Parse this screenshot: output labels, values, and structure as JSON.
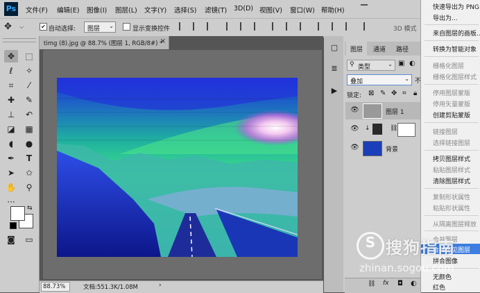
{
  "menubar": {
    "logo": "Ps",
    "items": [
      "文件(F)",
      "编辑(E)",
      "图像(I)",
      "图层(L)",
      "文字(Y)",
      "选择(S)",
      "滤镜(T)",
      "3D(D)",
      "视图(V)",
      "窗口(W)",
      "帮助(H)"
    ]
  },
  "options": {
    "auto_select_label": "自动选择:",
    "auto_select_value": "图层",
    "show_transform_label": "显示变换控件",
    "mode_3d": "3D 模式"
  },
  "document": {
    "tab_title": "timg (8).jpg @ 88.7% (图层 1, RGB/8#) *",
    "zoom": "88.73%",
    "doc_info": "文档:551.3K/1.08M"
  },
  "panels": {
    "tabs": [
      "图层",
      "通道",
      "路径"
    ],
    "filter_kind": "类型",
    "blend_mode": "叠加",
    "opacity_partial": "不",
    "lock_label": "锁定:",
    "layers": [
      {
        "name": "图层 1"
      },
      {
        "name": "背景"
      }
    ]
  },
  "context_menu": {
    "items": [
      {
        "label": "快速导出为 PNG",
        "disabled": false
      },
      {
        "label": "导出为...",
        "disabled": false
      },
      {
        "label": "来自图层的画板...",
        "disabled": false
      },
      {
        "label": "转换为智能对象",
        "disabled": false
      },
      {
        "label": "栅格化图层",
        "disabled": true
      },
      {
        "label": "栅格化图层样式",
        "disabled": true
      },
      {
        "label": "停用图层蒙版",
        "disabled": true
      },
      {
        "label": "停用矢量蒙版",
        "disabled": true
      },
      {
        "label": "创建剪贴蒙版",
        "disabled": false
      },
      {
        "label": "链接图层",
        "disabled": true
      },
      {
        "label": "选择链接图层",
        "disabled": true
      },
      {
        "label": "拷贝图层样式",
        "disabled": false
      },
      {
        "label": "粘贴图层样式",
        "disabled": true
      },
      {
        "label": "清除图层样式",
        "disabled": false
      },
      {
        "label": "复制形状属性",
        "disabled": true
      },
      {
        "label": "粘贴形状属性",
        "disabled": true
      },
      {
        "label": "从隔离图层释放",
        "disabled": true
      },
      {
        "label": "合并图层",
        "disabled": true
      },
      {
        "label": "合并可见图层",
        "disabled": false,
        "highlighted": true
      },
      {
        "label": "拼合图像",
        "disabled": false
      },
      {
        "label": "无颜色",
        "disabled": false
      },
      {
        "label": "红色",
        "disabled": false
      }
    ]
  },
  "watermark": {
    "brand": "搜狗指南",
    "url": "zhinan.sogou.com"
  },
  "colors": {
    "highlight": "#3d7ee0",
    "ui_gray": "#cdcdcd",
    "workspace": "#535353"
  }
}
